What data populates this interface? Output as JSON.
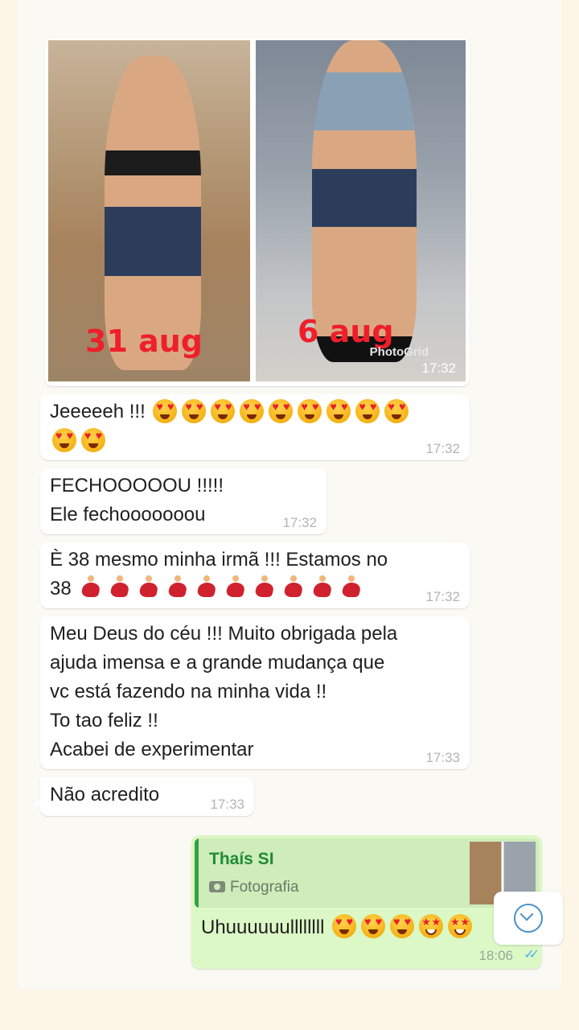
{
  "photo_message": {
    "left_caption": "31 aug",
    "right_caption": "6 aug",
    "watermark": "PhotoGrid",
    "time": "17:32"
  },
  "messages": [
    {
      "lines": [
        "Jeeeeeh !!!"
      ],
      "emojis": "heart-eyes x11",
      "time": "17:32"
    },
    {
      "lines": [
        "FECHOOOOOU !!!!!",
        "Ele fechooooooou"
      ],
      "time": "17:32"
    },
    {
      "lines": [
        "È 38 mesmo minha irmã !!! Estamos no",
        "38"
      ],
      "emojis": "dancer x10",
      "time": "17:32"
    },
    {
      "lines": [
        "Meu Deus do céu !!! Muito obrigada pela",
        "ajuda imensa e a grande mudança que",
        "vc está fazendo na minha vida !!",
        "To tao feliz !!",
        "Acabei de experimentar"
      ],
      "time": "17:33"
    },
    {
      "lines": [
        "Não acredito"
      ],
      "time": "17:33"
    }
  ],
  "reply": {
    "quoted_author": "Thaís SI",
    "quoted_type": "Fotografia",
    "text": "Uhuuuuuullllllll",
    "time": "18:06",
    "status": "read"
  },
  "icons": {
    "camera": "camera-icon",
    "scroll": "scroll-down-icon",
    "ticks": "double-check-icon"
  },
  "colors": {
    "incoming_bubble": "#ffffff",
    "outgoing_bubble": "#dcf8c6",
    "quote_author": "#1e8c34",
    "caption_red": "#ee1f2b"
  }
}
